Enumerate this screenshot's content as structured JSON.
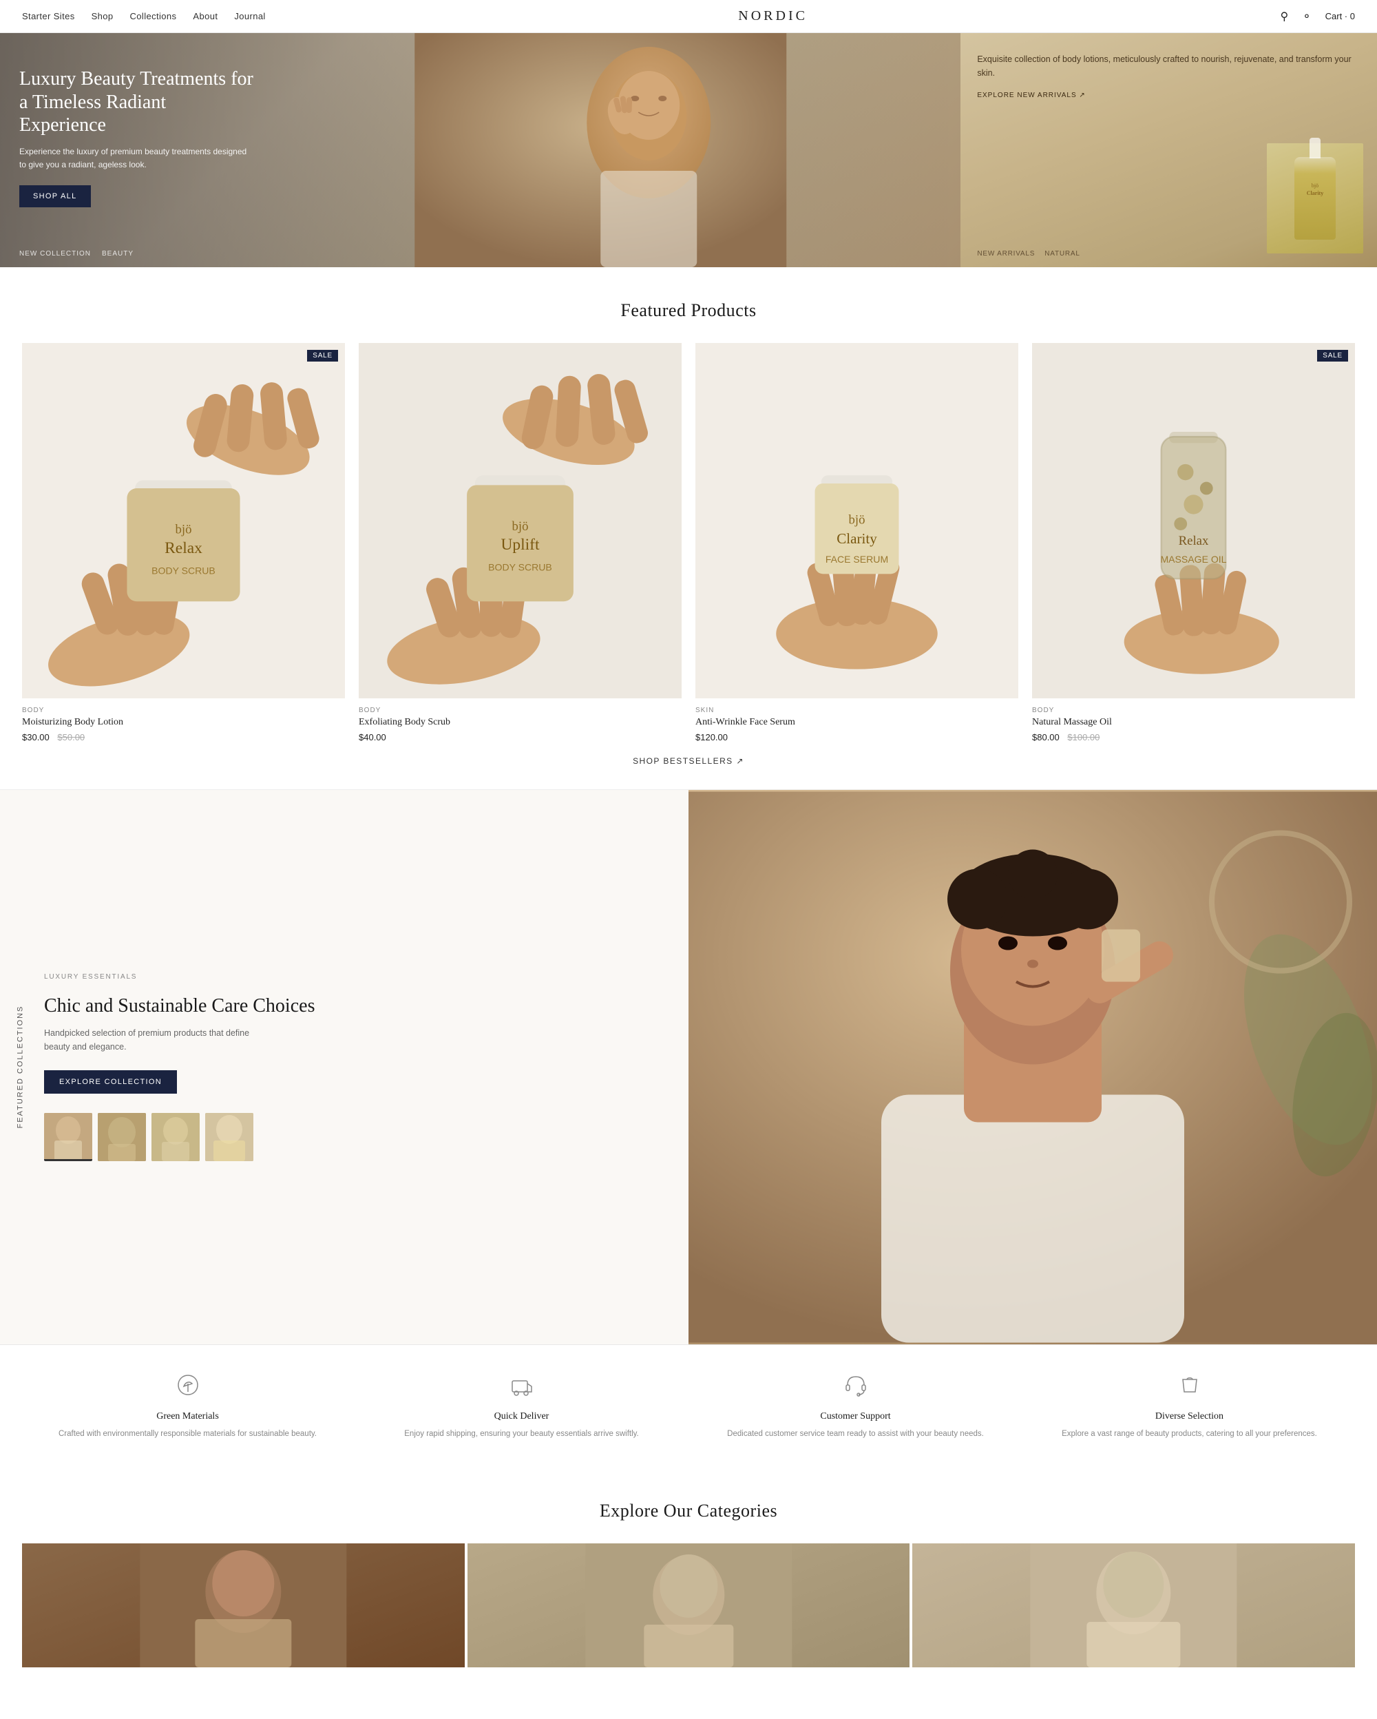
{
  "nav": {
    "links": [
      {
        "label": "Starter Sites",
        "id": "starter-sites"
      },
      {
        "label": "Shop",
        "id": "shop"
      },
      {
        "label": "Collections",
        "id": "collections"
      },
      {
        "label": "About",
        "id": "about"
      },
      {
        "label": "Journal",
        "id": "journal"
      }
    ],
    "brand": "NORDIC",
    "cart_label": "Cart · 0"
  },
  "hero": {
    "main": {
      "title": "Luxury Beauty Treatments for a Timeless Radiant Experience",
      "subtitle": "Experience the luxury of premium beauty treatments designed to give you a radiant, ageless look.",
      "cta_label": "SHOP ALL",
      "tags": [
        "NEW COLLECTION",
        "BEAUTY"
      ]
    },
    "side": {
      "text": "Exquisite collection of body lotions, meticulously crafted to nourish, rejuvenate, and transform your skin.",
      "link_label": "EXPLORE NEW ARRIVALS ↗",
      "product_name": "Clarity",
      "tags": [
        "NEW ARRIVALS",
        "NATURAL"
      ]
    }
  },
  "featured_products": {
    "section_title": "Featured Products",
    "products": [
      {
        "id": "p1",
        "category": "BODY",
        "name": "Moisturizing Body Lotion",
        "price": "$30.00",
        "original_price": "$50.00",
        "sale": true,
        "label_line1": "bjö",
        "label_line2": "Relax",
        "jar_color": "#d4c090"
      },
      {
        "id": "p2",
        "category": "BODY",
        "name": "Exfoliating Body Scrub",
        "price": "$40.00",
        "original_price": null,
        "sale": false,
        "label_line1": "bjö",
        "label_line2": "Uplift",
        "jar_color": "#d4c090"
      },
      {
        "id": "p3",
        "category": "SKIN",
        "name": "Anti-Wrinkle Face Serum",
        "price": "$120.00",
        "original_price": null,
        "sale": false,
        "label_line1": "bjö",
        "label_line2": "Clarity",
        "jar_color": "#e8d8b0"
      },
      {
        "id": "p4",
        "category": "BODY",
        "name": "Natural Massage Oil",
        "price": "$80.00",
        "original_price": "$100.00",
        "sale": true,
        "label_line1": "bjö",
        "label_line2": "Relax",
        "jar_color": "#c8b880"
      }
    ],
    "shop_link_label": "SHOP BESTSELLERS ↗"
  },
  "collections": {
    "label": "LUXURY ESSENTIALS",
    "title": "Chic and Sustainable Care Choices",
    "subtitle": "Handpicked selection of premium products that define beauty and elegance.",
    "cta_label": "EXPLORE COLLECTION",
    "rotated_label": "Featured Collections"
  },
  "features": [
    {
      "id": "f1",
      "icon": "🌿",
      "title": "Green Materials",
      "desc": "Crafted with environmentally responsible materials for sustainable beauty."
    },
    {
      "id": "f2",
      "icon": "📦",
      "title": "Quick Deliver",
      "desc": "Enjoy rapid shipping, ensuring your beauty essentials arrive swiftly."
    },
    {
      "id": "f3",
      "icon": "💬",
      "title": "Customer Support",
      "desc": "Dedicated customer service team ready to assist with your beauty needs."
    },
    {
      "id": "f4",
      "icon": "🛍",
      "title": "Diverse Selection",
      "desc": "Explore a vast range of beauty products, catering to all your preferences."
    }
  ],
  "explore": {
    "section_title": "Explore Our Categories"
  }
}
